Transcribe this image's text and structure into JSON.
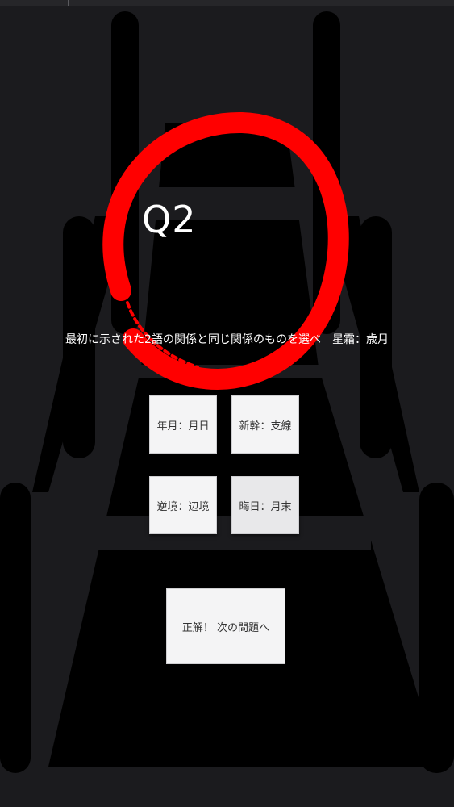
{
  "quiz": {
    "question_number": "Q2",
    "question_text": "最初に示された2語の関係と同じ関係のものを選べ　星霜：歳月",
    "options": [
      {
        "label": "年月：月日"
      },
      {
        "label": "新幹：支線"
      },
      {
        "label": "逆境：辺境"
      },
      {
        "label": "晦日：月末"
      }
    ],
    "next_label": "正解！ 次の問題へ",
    "result_mark": "correct-circle"
  },
  "colors": {
    "background": "#1b1b1e",
    "silhouette": "#000000",
    "button_bg": "#f4f4f5",
    "mark_red": "#ff0000",
    "text": "#ffffff"
  }
}
